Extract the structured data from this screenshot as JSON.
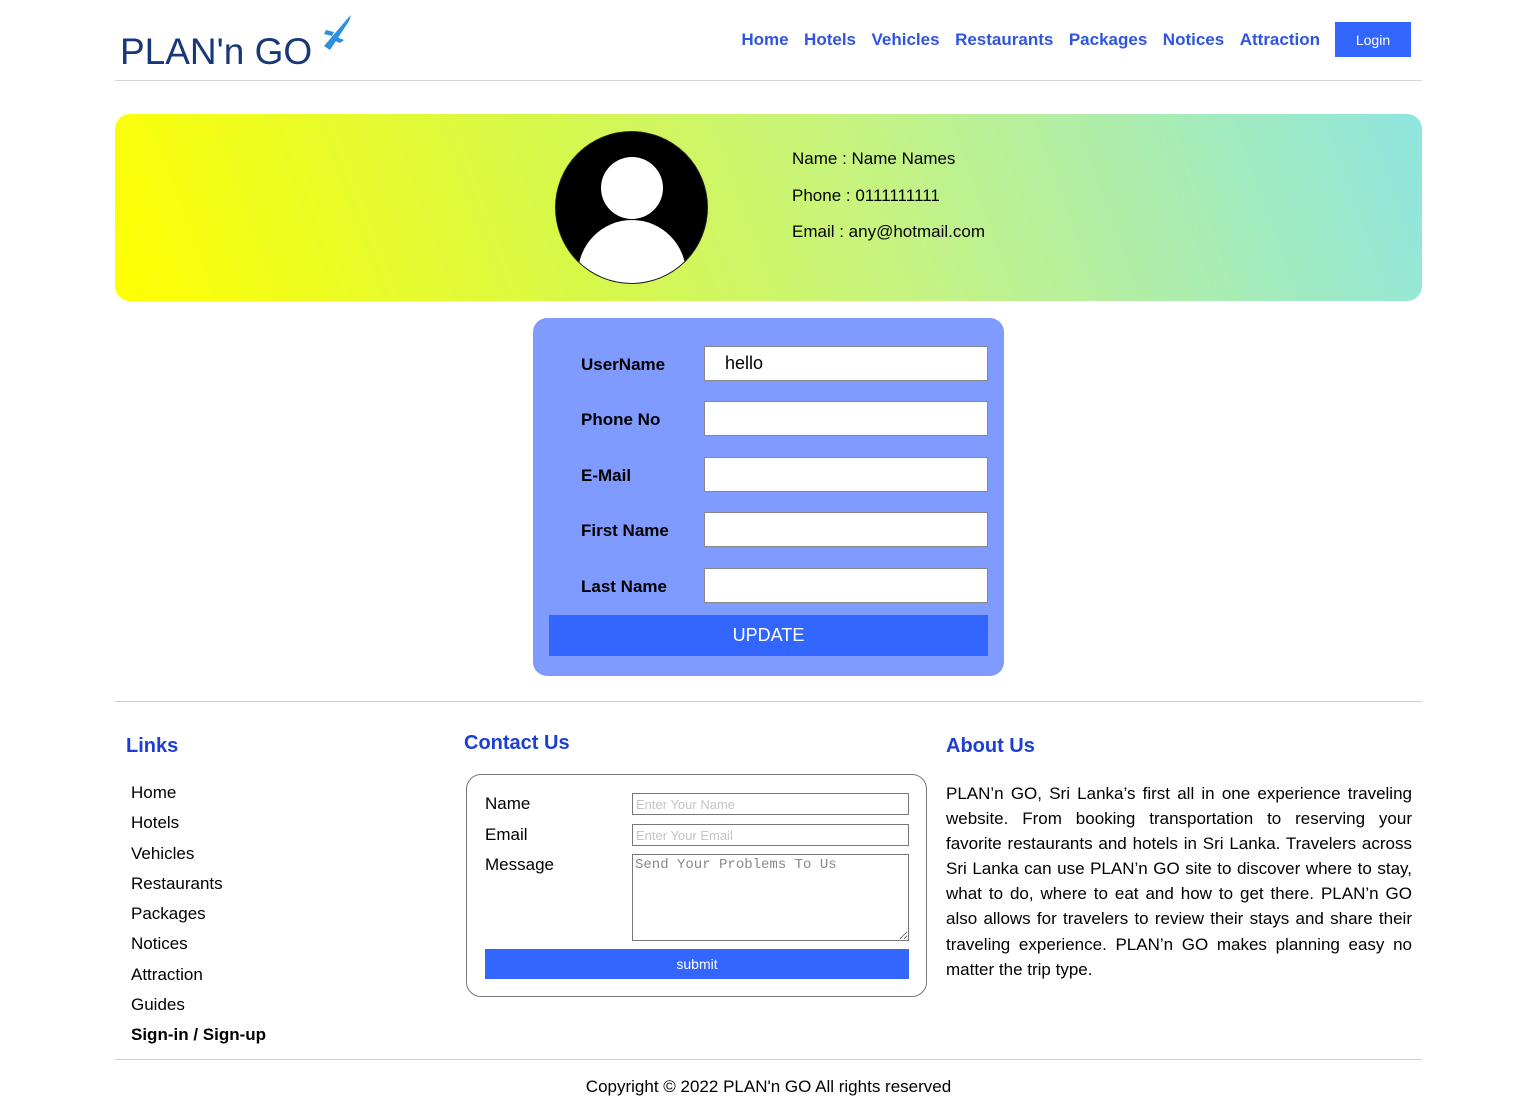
{
  "header": {
    "logo_text": "PLAN'n GO",
    "nav": [
      "Home",
      "Hotels",
      "Vehicles",
      "Restaurants",
      "Packages",
      "Notices",
      "Attraction"
    ],
    "login_label": "Login"
  },
  "profile": {
    "name_line": "Name : Name Names",
    "phone_line": "Phone : 0111111111",
    "email_line": "Email : any@hotmail.com"
  },
  "update_form": {
    "fields": [
      {
        "label": "UserName",
        "value": "hello"
      },
      {
        "label": "Phone No",
        "value": ""
      },
      {
        "label": "E-Mail",
        "value": ""
      },
      {
        "label": "First Name",
        "value": ""
      },
      {
        "label": "Last Name",
        "value": ""
      }
    ],
    "button_label": "UPDATE"
  },
  "footer": {
    "links_title": "Links",
    "links": [
      "Home",
      "Hotels",
      "Vehicles",
      "Restaurants",
      "Packages",
      "Notices",
      "Attraction",
      "Guides",
      "Sign-in / Sign-up"
    ],
    "contact_title": "Contact Us",
    "contact": {
      "name_label": "Name",
      "name_placeholder": "Enter Your Name",
      "email_label": "Email",
      "email_placeholder": "Enter Your Email",
      "message_label": "Message",
      "message_placeholder": "Send Your Problems To Us",
      "submit_label": "submit"
    },
    "about_title": "About Us",
    "about_text": "PLAN’n GO, Sri Lanka’s first all in one experience traveling website. From booking transportation to reserving your favorite restaurants and hotels in Sri Lanka. Travelers across Sri Lanka can use PLAN’n GO site to discover where to stay, what to do, where to eat and how to get there. PLAN’n GO also allows for travelers to review their stays and share their traveling experience. PLAN’n GO makes planning easy no matter the trip type.",
    "copyright": "Copyright © 2022 PLAN'n GO All rights reserved"
  },
  "colors": {
    "brand_blue": "#3366ff",
    "nav_blue": "#2f55e0",
    "footer_title_blue": "#1d3ed6",
    "form_bg": "#7f9bff"
  }
}
